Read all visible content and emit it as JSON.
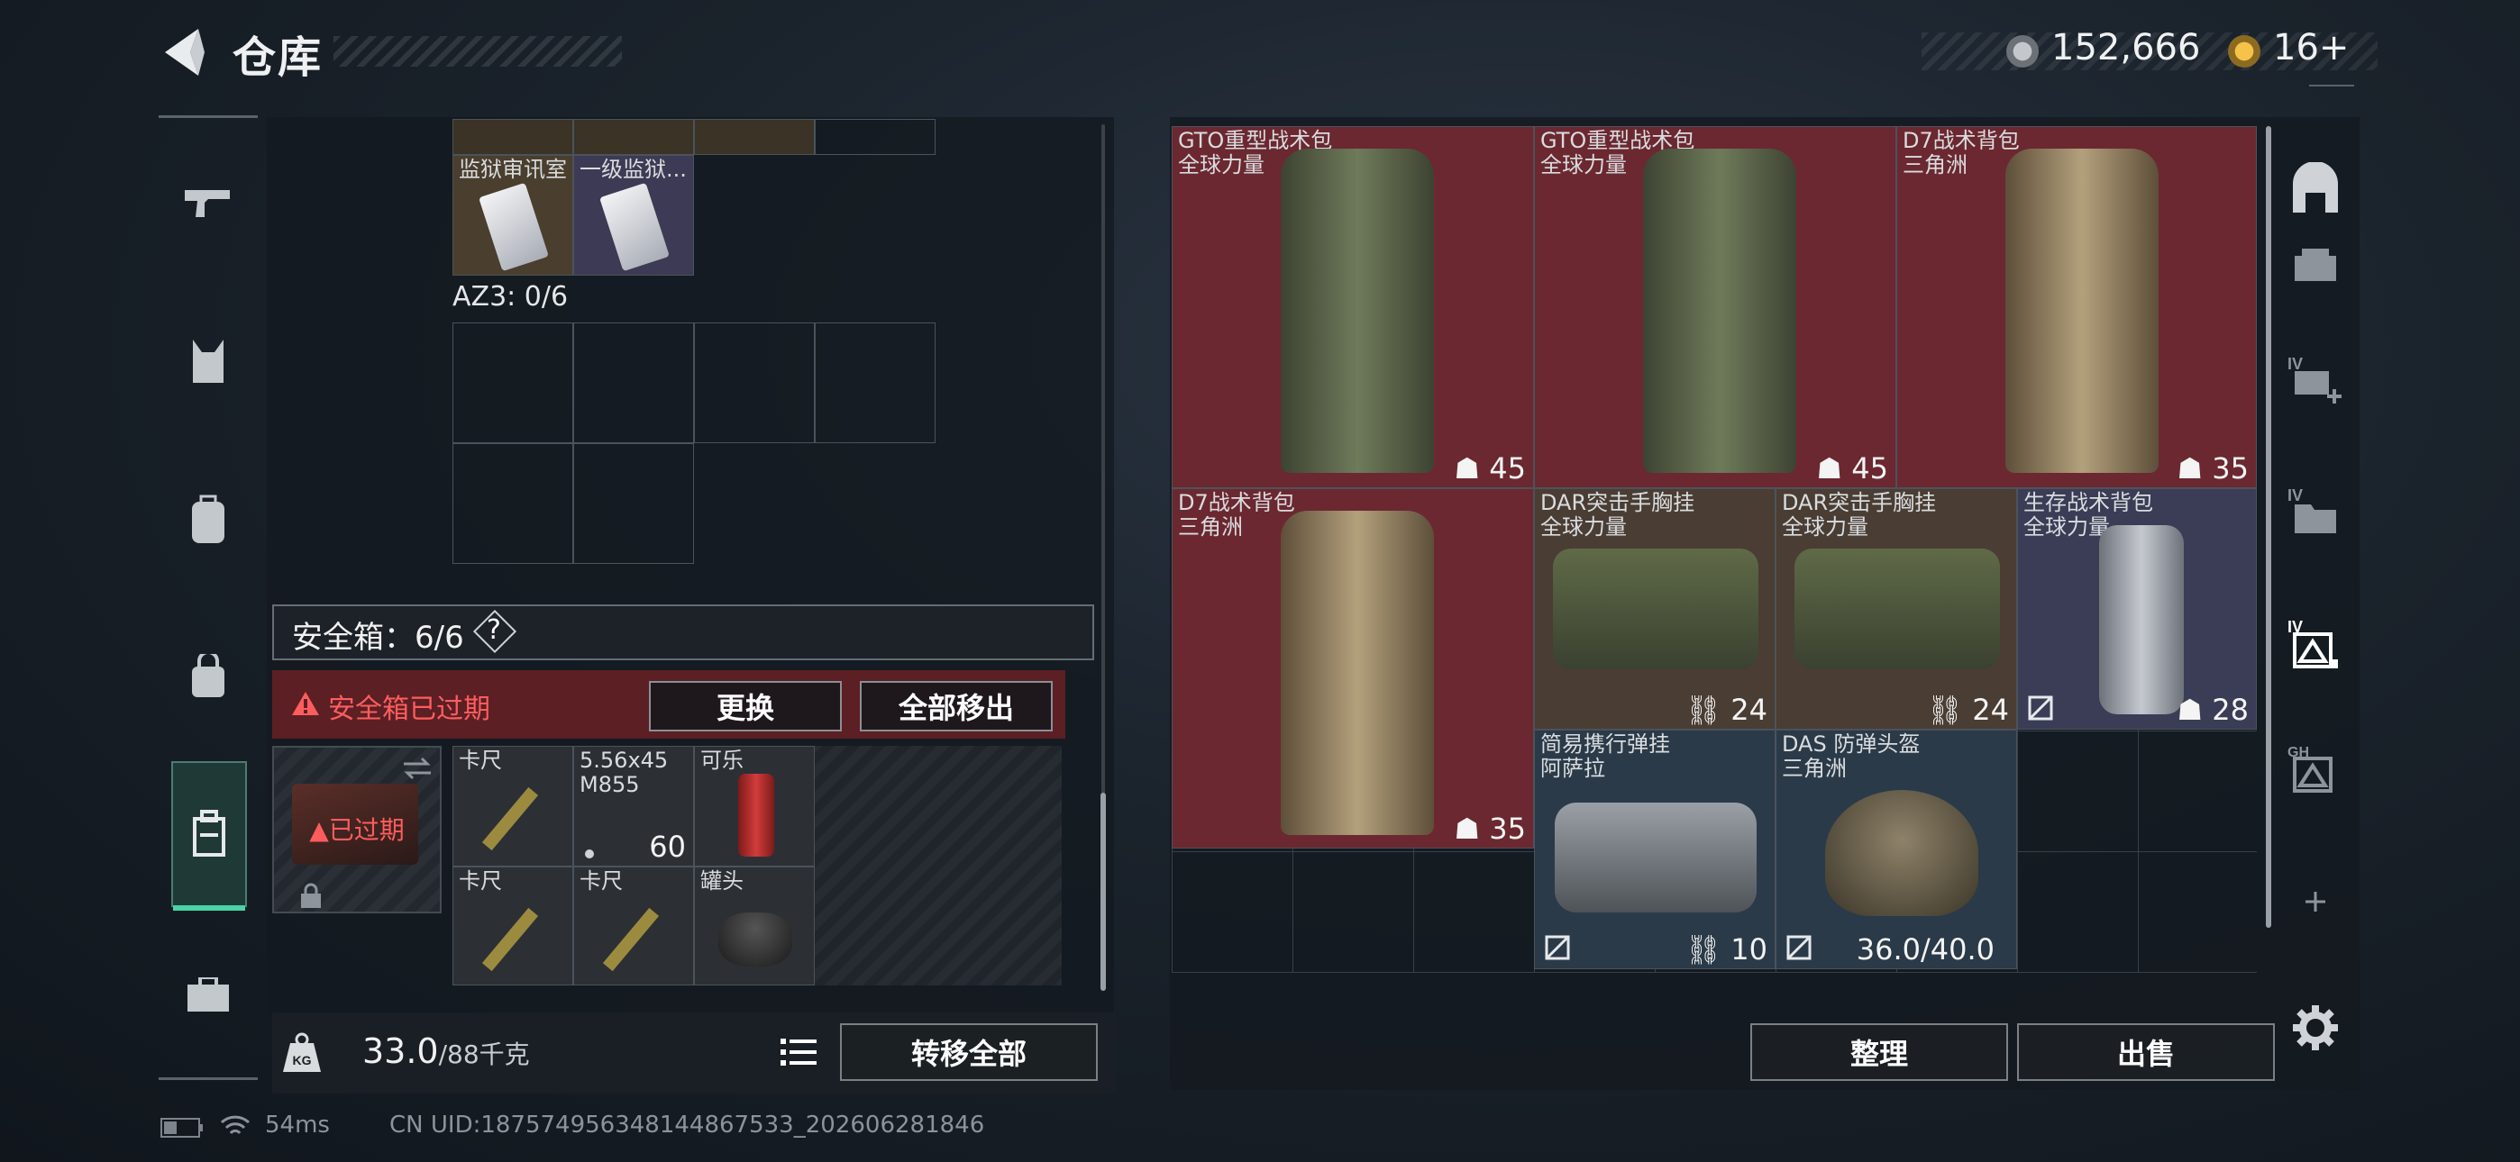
{
  "header": {
    "title": "仓库",
    "currency_1": "152,666",
    "currency_2": "16+"
  },
  "left_nav": {
    "items": [
      "pistol",
      "vest",
      "backpack",
      "pouch",
      "safe-box",
      "briefcase"
    ],
    "active": "safe-box"
  },
  "warehouse_left": {
    "top_items": [
      {
        "label": "监狱审讯室"
      },
      {
        "label": "一级监狱..."
      }
    ],
    "container_label": "AZ3: 0/6",
    "safe_box": {
      "label": "安全箱：6/6",
      "help": "?"
    },
    "warning": {
      "text": "安全箱已过期",
      "replace_label": "更换",
      "remove_all_label": "全部移出"
    },
    "expired_label": "已过期",
    "safe_items": [
      {
        "label": "卡尺"
      },
      {
        "label": "5.56x45\nM855",
        "count": "60"
      },
      {
        "label": "可乐"
      },
      {
        "label": "卡尺"
      },
      {
        "label": "卡尺"
      },
      {
        "label": "罐头"
      }
    ],
    "weight": {
      "current": "33.0",
      "max": "/88千克"
    },
    "transfer_all_label": "转移全部"
  },
  "warehouse_right": {
    "items": [
      {
        "name": "GTO重型战术包",
        "brand": "全球力量",
        "count": "45",
        "color": "#6b2830"
      },
      {
        "name": "GTO重型战术包",
        "brand": "全球力量",
        "count": "45",
        "color": "#6b2830"
      },
      {
        "name": "D7战术背包",
        "brand": "三角洲",
        "count": "35",
        "color": "#6b2830"
      },
      {
        "name": "D7战术背包",
        "brand": "三角洲",
        "count": "35",
        "color": "#6b2830"
      },
      {
        "name": "DAR突击手胸挂",
        "brand": "全球力量",
        "count": "24",
        "color": "#4a3d33"
      },
      {
        "name": "DAR突击手胸挂",
        "brand": "全球力量",
        "count": "24",
        "color": "#4a3d33"
      },
      {
        "name": "生存战术背包",
        "brand": "全球力量",
        "count": "28",
        "color": "#3a3d55"
      },
      {
        "name": "简易携行弹挂",
        "brand": "阿萨拉",
        "count": "10",
        "color": "#2b3a48"
      },
      {
        "name": "DAS 防弹头盔",
        "brand": "三角洲",
        "count": "36.0/40.0",
        "color": "#2b3a48"
      }
    ],
    "sort_label": "整理",
    "sell_label": "出售"
  },
  "status_bar": {
    "ping": "54ms",
    "uid": "CN UID:187574956348144867533_202606281846"
  }
}
